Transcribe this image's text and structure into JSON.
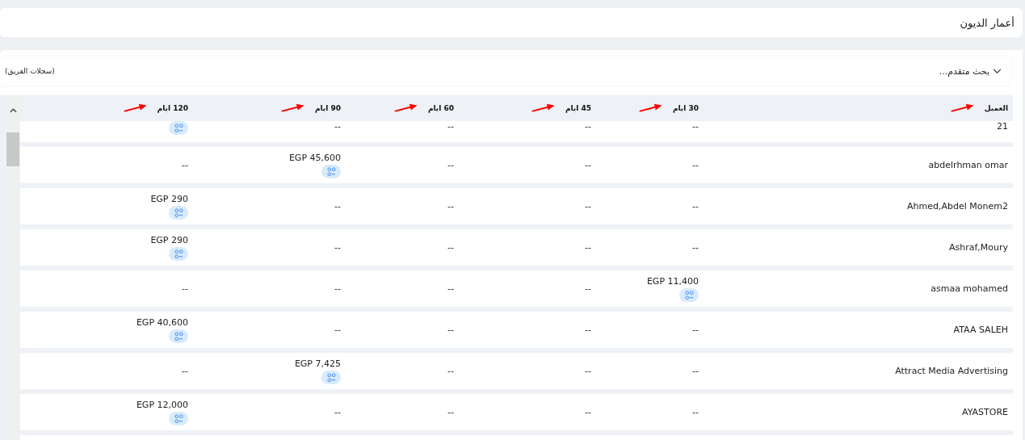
{
  "page_title": "أعمار الديون",
  "filter_bar": {
    "advanced_search": "بحث متقدم...",
    "scope": "(سجلات الفريق)"
  },
  "table": {
    "columns": [
      "العميل",
      "30 ايام",
      "45 ايام",
      "60 ايام",
      "90 ايام",
      "120 ايام"
    ],
    "rows": [
      {
        "cells": [
          {
            "text": "21",
            "chip": false
          },
          {
            "text": "--",
            "chip": false
          },
          {
            "text": "--",
            "chip": false
          },
          {
            "text": "--",
            "chip": false
          },
          {
            "text": "--",
            "chip": false
          },
          {
            "chip": true
          }
        ]
      },
      {
        "cells": [
          {
            "text": "abdelrhman omar",
            "chip": false
          },
          {
            "text": "--",
            "chip": false
          },
          {
            "text": "--",
            "chip": false
          },
          {
            "text": "--",
            "chip": false
          },
          {
            "text": "EGP 45,600",
            "chip": true
          },
          {
            "text": "--",
            "chip": false
          }
        ]
      },
      {
        "cells": [
          {
            "text": "Ahmed,Abdel Monem2",
            "chip": false
          },
          {
            "text": "--",
            "chip": false
          },
          {
            "text": "--",
            "chip": false
          },
          {
            "text": "--",
            "chip": false
          },
          {
            "text": "--",
            "chip": false
          },
          {
            "text": "EGP 290",
            "chip": true
          }
        ]
      },
      {
        "cells": [
          {
            "text": "Ashraf,Moury",
            "chip": false
          },
          {
            "text": "--",
            "chip": false
          },
          {
            "text": "--",
            "chip": false
          },
          {
            "text": "--",
            "chip": false
          },
          {
            "text": "--",
            "chip": false
          },
          {
            "text": "EGP 290",
            "chip": true
          }
        ]
      },
      {
        "cells": [
          {
            "text": "asmaa mohamed",
            "chip": false
          },
          {
            "text": "EGP 11,400",
            "chip": true
          },
          {
            "text": "--",
            "chip": false
          },
          {
            "text": "--",
            "chip": false
          },
          {
            "text": "--",
            "chip": false
          },
          {
            "text": "--",
            "chip": false
          }
        ]
      },
      {
        "cells": [
          {
            "text": "ATAA SALEH",
            "chip": false
          },
          {
            "text": "--",
            "chip": false
          },
          {
            "text": "--",
            "chip": false
          },
          {
            "text": "--",
            "chip": false
          },
          {
            "text": "--",
            "chip": false
          },
          {
            "text": "EGP 40,600",
            "chip": true
          }
        ]
      },
      {
        "cells": [
          {
            "text": "Attract Media Advertising",
            "chip": false
          },
          {
            "text": "--",
            "chip": false
          },
          {
            "text": "--",
            "chip": false
          },
          {
            "text": "--",
            "chip": false
          },
          {
            "text": "EGP 7,425",
            "chip": true
          },
          {
            "text": "--",
            "chip": false
          }
        ]
      },
      {
        "cells": [
          {
            "text": "AYASTORE",
            "chip": false
          },
          {
            "text": "--",
            "chip": false
          },
          {
            "text": "--",
            "chip": false
          },
          {
            "text": "--",
            "chip": false
          },
          {
            "text": "--",
            "chip": false
          },
          {
            "text": "EGP 12,000",
            "chip": true
          }
        ]
      }
    ]
  }
}
